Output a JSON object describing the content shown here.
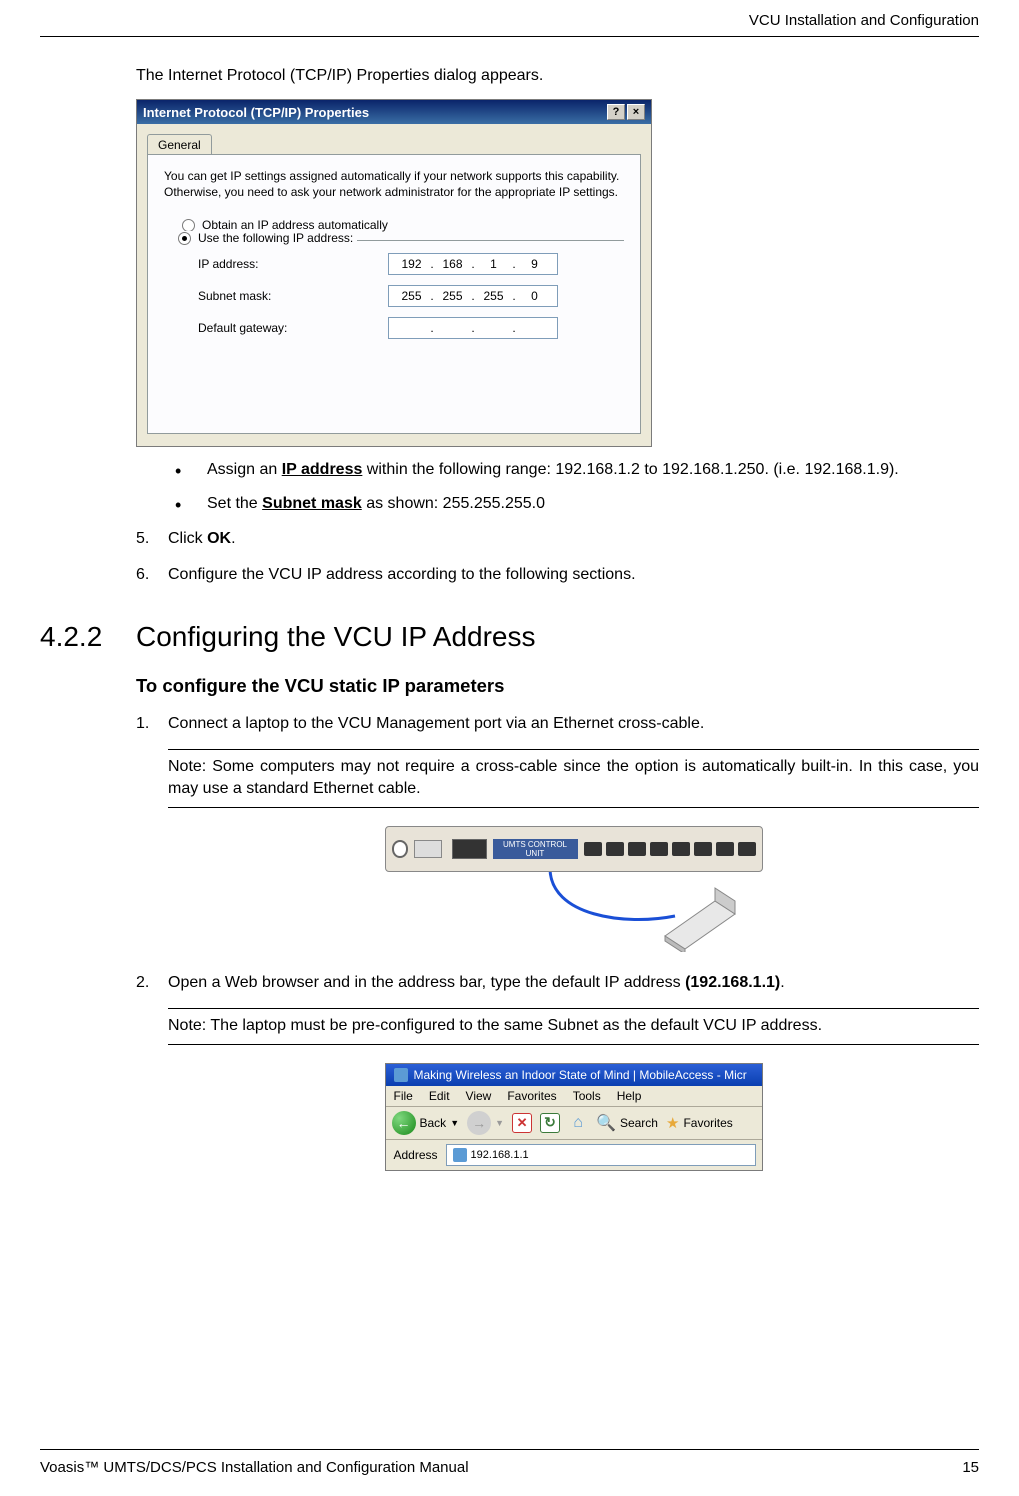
{
  "headerRight": "VCU Installation and Configuration",
  "introText": "The Internet Protocol (TCP/IP) Properties dialog appears.",
  "dialog": {
    "title": "Internet Protocol (TCP/IP) Properties",
    "tab": "General",
    "description": "You can get IP settings assigned automatically if your network supports this capability. Otherwise, you need to ask your network administrator for the appropriate IP settings.",
    "radio1": "Obtain an IP address automatically",
    "radio2": "Use the following IP address:",
    "ipLabel": "IP address:",
    "ipValue": {
      "a": "192",
      "b": "168",
      "c": "1",
      "d": "9"
    },
    "subnetLabel": "Subnet mask:",
    "subnetValue": {
      "a": "255",
      "b": "255",
      "c": "255",
      "d": "0"
    },
    "gatewayLabel": "Default gateway:"
  },
  "bullet1": {
    "pre": "Assign an ",
    "bold": "IP address",
    "post": " within the following range: 192.168.1.2 to 192.168.1.250. (i.e. 192.168.1.9)."
  },
  "bullet2": {
    "pre": "Set the ",
    "bold": "Subnet mask",
    "post": " as shown: 255.255.255.0"
  },
  "step5": {
    "num": "5.",
    "pre": "Click ",
    "bold": "OK",
    "post": "."
  },
  "step6": {
    "num": "6.",
    "text": "Configure the VCU IP address according to the following sections."
  },
  "section": {
    "num": "4.2.2",
    "title": "Configuring the VCU IP Address"
  },
  "subHeading": "To configure the VCU static IP parameters",
  "cfgStep1": {
    "num": "1.",
    "text": "Connect a laptop to the VCU Management port via an Ethernet cross-cable."
  },
  "note1": "Note: Some computers may not require a cross-cable since the option is automatically built-in. In this case, you may use a standard Ethernet cable.",
  "vcuLabel": "UMTS CONTROL UNIT",
  "cfgStep2": {
    "num": "2.",
    "pre": "Open a Web browser and in the address bar, type the default IP address ",
    "bold": "(192.168.1.1)",
    "post": "."
  },
  "note2": "Note: The laptop must be pre-configured to the same Subnet as the default VCU IP address.",
  "browser": {
    "title": "Making Wireless an Indoor State of Mind | MobileAccess - Micr",
    "menu": [
      "File",
      "Edit",
      "View",
      "Favorites",
      "Tools",
      "Help"
    ],
    "back": "Back",
    "search": "Search",
    "favorites": "Favorites",
    "addressLabel": "Address",
    "addressValue": "192.168.1.1"
  },
  "footerLeft": "Voasis™ UMTS/DCS/PCS Installation and Configuration Manual",
  "footerRight": "15"
}
